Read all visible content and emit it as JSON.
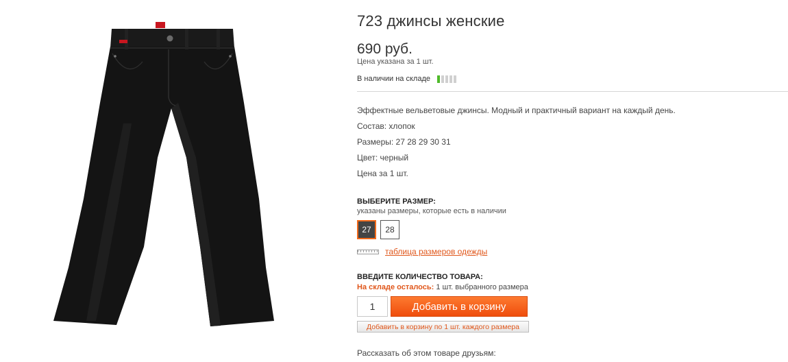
{
  "product": {
    "title": "723 джинсы женские",
    "image_alt": "black corduroy flare jeans",
    "price": "690 руб.",
    "price_note": "Цена указана за 1 шт.",
    "stock_label": "В наличии на складе",
    "stock_level": 0.2
  },
  "description": [
    "Эффектные  вельветовые джинсы. Модный и практичный вариант на каждый день.",
    "Состав: хлопок",
    "Размеры: 27 28 29 30 31",
    "Цвет: черный",
    "Цена за 1 шт."
  ],
  "size_select": {
    "heading": "ВЫБЕРИТЕ РАЗМЕР:",
    "subtext": "указаны размеры, которые есть в наличии",
    "sizes": [
      "27",
      "28"
    ],
    "selected": "27",
    "chart_link": "таблица размеров одежды"
  },
  "quantity": {
    "heading": "ВВЕДИТЕ КОЛИЧЕСТВО ТОВАРА:",
    "stock_left_label": "На складе осталось:",
    "stock_left_value": "1 шт. выбранного размера",
    "value": "1"
  },
  "buttons": {
    "add_to_cart": "Добавить в корзину",
    "add_each_size": "Добавить в корзину по 1 шт. каждого размера"
  },
  "share_label": "Рассказать об этом товаре друзьям:",
  "colors": {
    "accent": "#ef4d0c",
    "link": "#e0561a",
    "stock_on": "#4fba2a",
    "stock_off": "#d0d0d0"
  }
}
